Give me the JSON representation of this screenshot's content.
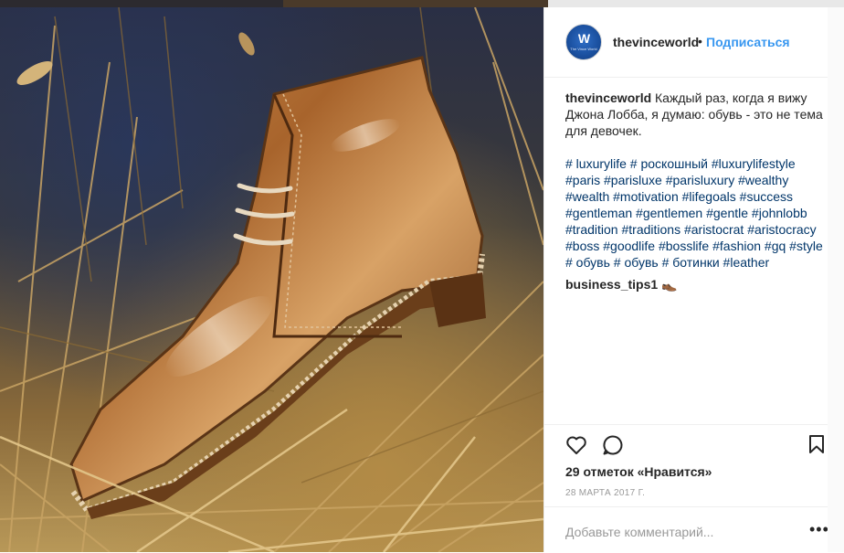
{
  "post": {
    "username": "thevinceworld",
    "dot": "•",
    "follow_label": "Подписаться",
    "avatar_monogram": "W",
    "avatar_small_text": "The Vince World",
    "caption_user": "thevinceworld",
    "caption_text": "Каждый раз, когда я вижу Джона Лобба, я думаю: обувь - это не тема для девочек.",
    "hashtags": "# luxurylife # роскошный #luxurylifestyle #paris #parisluxe #parisluxury #wealthy #wealth #motivation #lifegoals #success #gentleman #gentlemen #gentle #johnlobb #tradition #traditions #aristocrat #aristocracy #boss #goodlife #bosslife #fashion #gq #style # обувь # обувь # ботинки #leather",
    "comment_user": "business_tips1",
    "comment_emoji": "👞",
    "likes": "29 отметок «Нравится»",
    "date": "28 МАРТА 2017 Г.",
    "add_comment_placeholder": "Добавьте комментарий...",
    "more_label": "•••"
  },
  "icons": [
    "heart-icon",
    "comment-icon",
    "bookmark-icon",
    "more-options-icon"
  ],
  "colors": {
    "link": "#003569",
    "follow": "#3897f0",
    "text": "#262626",
    "muted": "#999999"
  }
}
